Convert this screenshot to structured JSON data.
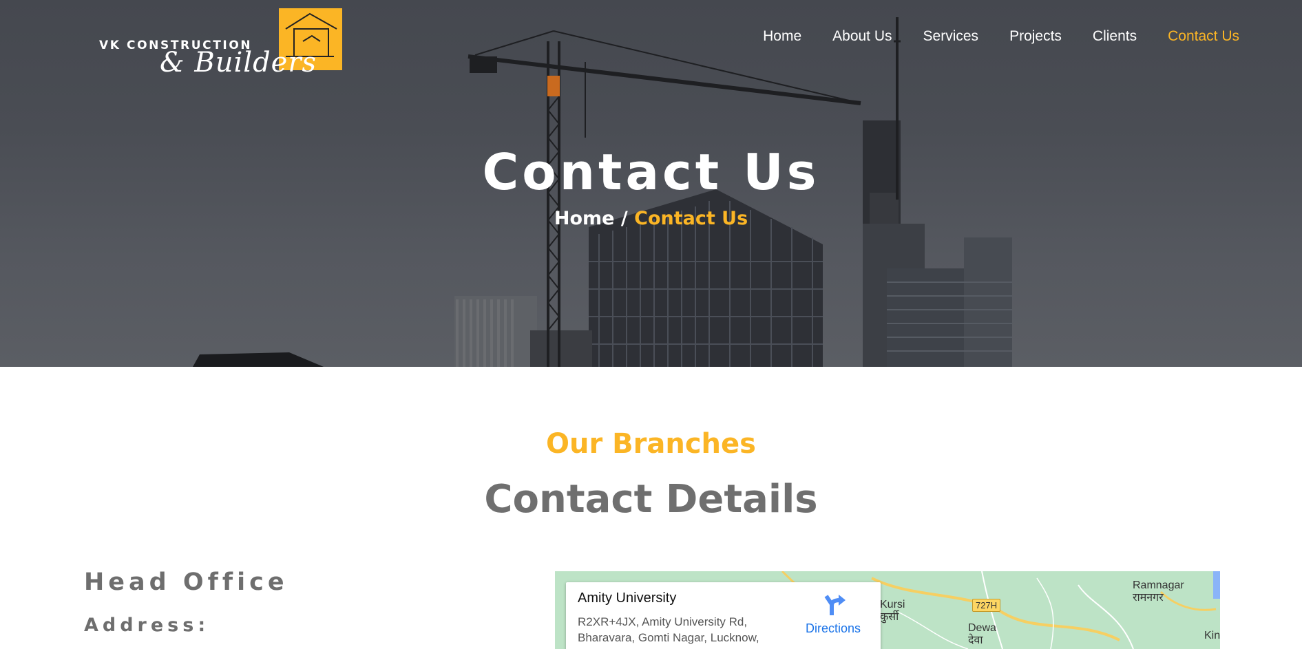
{
  "brand": {
    "line1": "VK CONSTRUCTION",
    "line2": "& Builders",
    "accent": "#fbb525"
  },
  "nav": {
    "items": [
      "Home",
      "About Us",
      "Services",
      "Projects",
      "Clients",
      "Contact Us"
    ],
    "active": "Contact Us"
  },
  "hero": {
    "title": "Contact Us",
    "breadcrumb_home": "Home",
    "breadcrumb_sep": "/",
    "breadcrumb_current": "Contact Us"
  },
  "section": {
    "kicker": "Our Branches",
    "heading": "Contact Details",
    "office_title": "Head Office",
    "address_label": "Address:"
  },
  "map": {
    "place_name": "Amity University",
    "place_address": "R2XR+4JX, Amity University Rd, Bharavara, Gomti Nagar, Lucknow,",
    "directions_label": "Directions",
    "icon": "directions-icon",
    "labels": {
      "kursi": "Kursi",
      "kursi_hi": "कुर्सी",
      "highway": "727H",
      "dewa": "Dewa",
      "dewa_hi": "देवा",
      "ramnagar": "Ramnagar",
      "ramnagar_hi": "रामनगर",
      "kin": "Kin"
    }
  },
  "colors": {
    "accent": "#fbb525",
    "heading_gray": "#6f6f6f",
    "link_blue": "#1a73e8"
  }
}
